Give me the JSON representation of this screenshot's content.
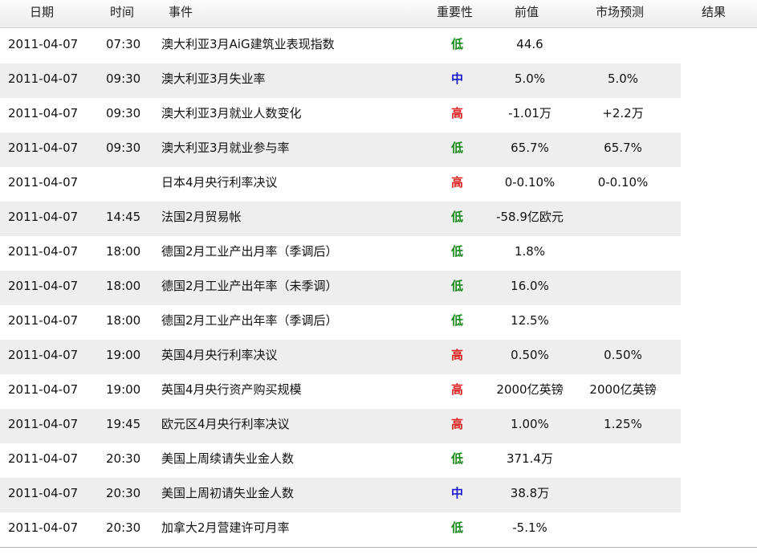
{
  "headers": {
    "date": "日期",
    "time": "时间",
    "event": "事件",
    "importance": "重要性",
    "previous": "前值",
    "forecast": "市场预测",
    "result": "结果"
  },
  "importance_colors": {
    "低": "#1a8a1a",
    "中": "#1a1acc",
    "高": "#dd2222"
  },
  "rows": [
    {
      "date": "2011-04-07",
      "time": "07:30",
      "event": "澳大利亚3月AiG建筑业表现指数",
      "importance": "低",
      "previous": "44.6",
      "forecast": "",
      "result": ""
    },
    {
      "date": "2011-04-07",
      "time": "09:30",
      "event": "澳大利亚3月失业率",
      "importance": "中",
      "previous": "5.0%",
      "forecast": "5.0%",
      "result": ""
    },
    {
      "date": "2011-04-07",
      "time": "09:30",
      "event": "澳大利亚3月就业人数变化",
      "importance": "高",
      "previous": "-1.01万",
      "forecast": "+2.2万",
      "result": ""
    },
    {
      "date": "2011-04-07",
      "time": "09:30",
      "event": "澳大利亚3月就业参与率",
      "importance": "低",
      "previous": "65.7%",
      "forecast": "65.7%",
      "result": ""
    },
    {
      "date": "2011-04-07",
      "time": "",
      "event": "日本4月央行利率决议",
      "importance": "高",
      "previous": "0-0.10%",
      "forecast": "0-0.10%",
      "result": ""
    },
    {
      "date": "2011-04-07",
      "time": "14:45",
      "event": "法国2月贸易帐",
      "importance": "低",
      "previous": "-58.9亿欧元",
      "forecast": "",
      "result": ""
    },
    {
      "date": "2011-04-07",
      "time": "18:00",
      "event": "德国2月工业产出月率（季调后）",
      "importance": "低",
      "previous": "1.8%",
      "forecast": "",
      "result": ""
    },
    {
      "date": "2011-04-07",
      "time": "18:00",
      "event": "德国2月工业产出年率（未季调）",
      "importance": "低",
      "previous": "16.0%",
      "forecast": "",
      "result": ""
    },
    {
      "date": "2011-04-07",
      "time": "18:00",
      "event": "德国2月工业产出年率（季调后）",
      "importance": "低",
      "previous": "12.5%",
      "forecast": "",
      "result": ""
    },
    {
      "date": "2011-04-07",
      "time": "19:00",
      "event": "英国4月央行利率决议",
      "importance": "高",
      "previous": "0.50%",
      "forecast": "0.50%",
      "result": ""
    },
    {
      "date": "2011-04-07",
      "time": "19:00",
      "event": "英国4月央行资产购买规模",
      "importance": "高",
      "previous": "2000亿英镑",
      "forecast": "2000亿英镑",
      "result": ""
    },
    {
      "date": "2011-04-07",
      "time": "19:45",
      "event": "欧元区4月央行利率决议",
      "importance": "高",
      "previous": "1.00%",
      "forecast": "1.25%",
      "result": ""
    },
    {
      "date": "2011-04-07",
      "time": "20:30",
      "event": "美国上周续请失业金人数",
      "importance": "低",
      "previous": "371.4万",
      "forecast": "",
      "result": ""
    },
    {
      "date": "2011-04-07",
      "time": "20:30",
      "event": "美国上周初请失业金人数",
      "importance": "中",
      "previous": "38.8万",
      "forecast": "",
      "result": ""
    },
    {
      "date": "2011-04-07",
      "time": "20:30",
      "event": "加拿大2月营建许可月率",
      "importance": "低",
      "previous": "-5.1%",
      "forecast": "",
      "result": ""
    }
  ]
}
